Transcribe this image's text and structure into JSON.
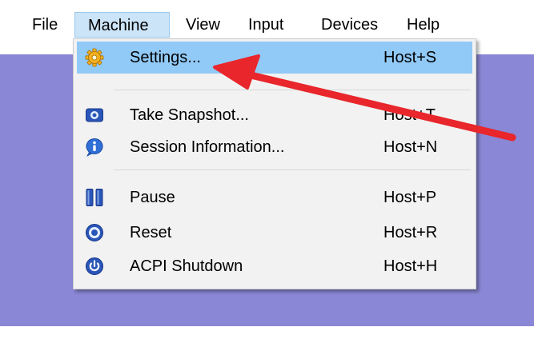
{
  "menubar": {
    "items": [
      {
        "label": "File"
      },
      {
        "label": "Machine"
      },
      {
        "label": "View"
      },
      {
        "label": "Input"
      },
      {
        "label": "Devices"
      },
      {
        "label": "Help"
      }
    ],
    "active": "Machine"
  },
  "machine_menu": {
    "items": [
      {
        "label": "Settings...",
        "shortcut": "Host+S",
        "icon": "gear-icon"
      },
      {
        "label": "Take Snapshot...",
        "shortcut": "Host+T",
        "icon": "camera-icon"
      },
      {
        "label": "Session Information...",
        "shortcut": "Host+N",
        "icon": "info-icon"
      },
      {
        "label": "Pause",
        "shortcut": "Host+P",
        "icon": "pause-icon"
      },
      {
        "label": "Reset",
        "shortcut": "Host+R",
        "icon": "reset-icon"
      },
      {
        "label": "ACPI Shutdown",
        "shortcut": "Host+H",
        "icon": "power-icon"
      }
    ],
    "highlighted": "Settings..."
  },
  "annotation": {
    "arrow_color": "#e8262b"
  },
  "colors": {
    "vm_background": "#8a87d6",
    "highlight": "#91c9f7"
  }
}
